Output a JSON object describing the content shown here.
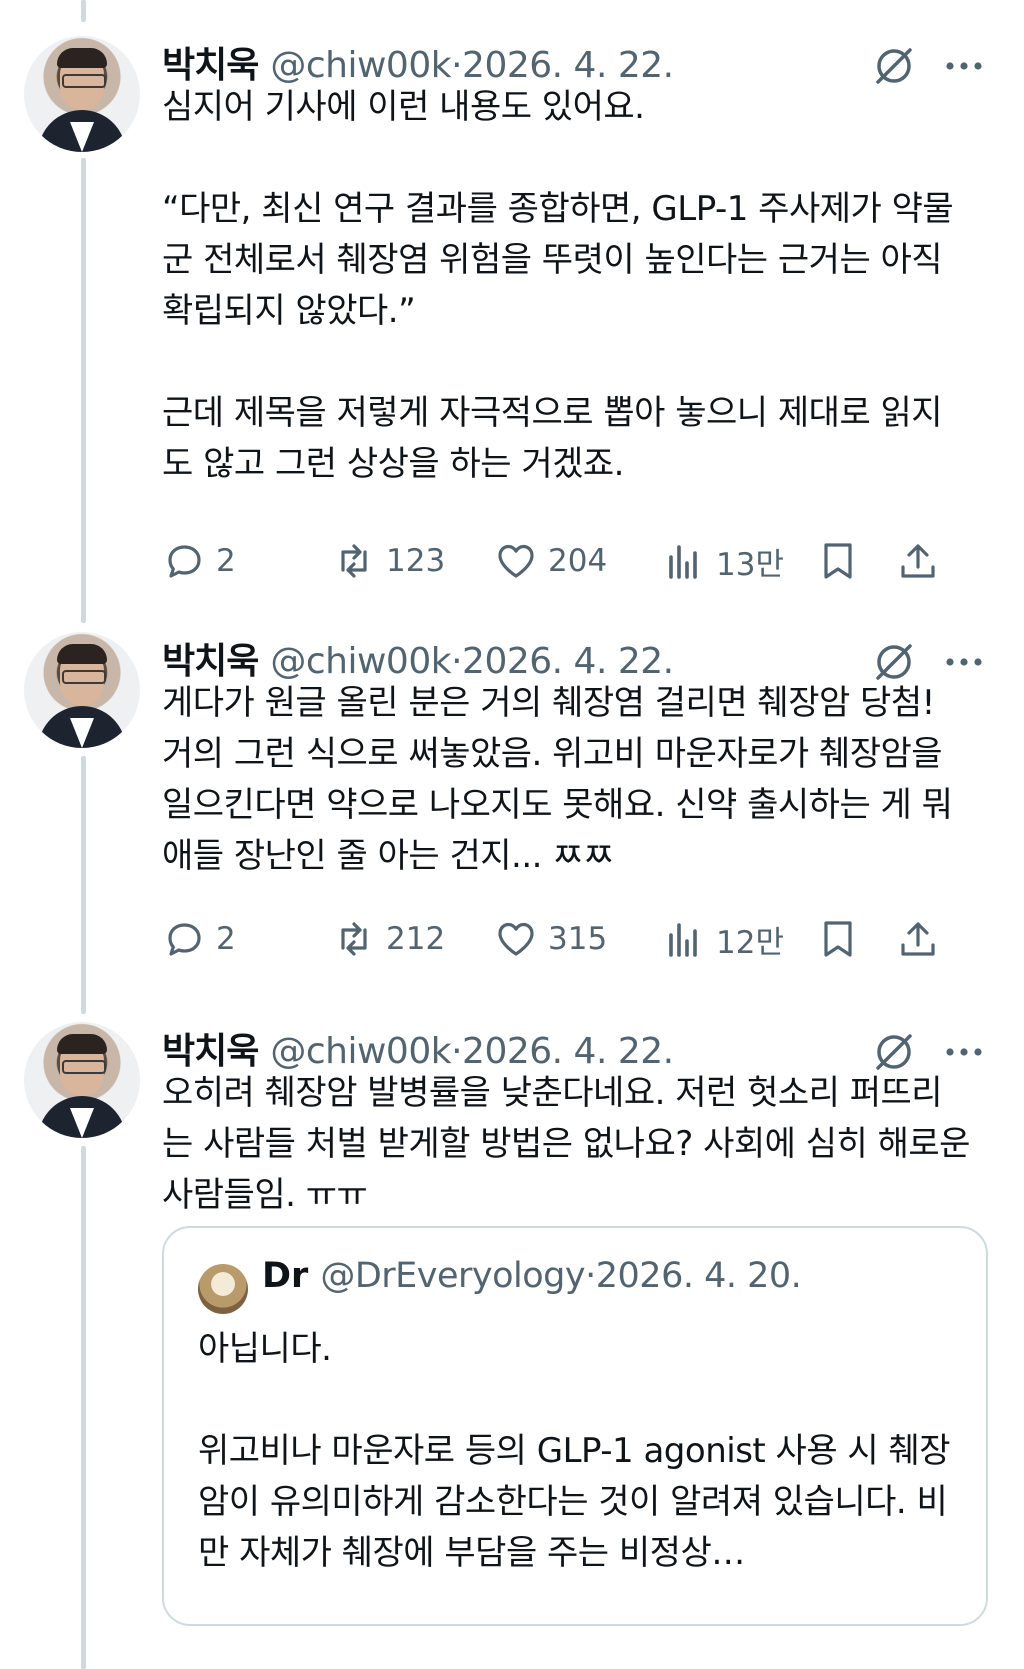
{
  "tweets": [
    {
      "name": "박치욱",
      "handle": "@chiw00k",
      "separator": "·",
      "date": "2026. 4. 22.",
      "text": "심지어 기사에 이런 내용도 있어요.\n\n“다만, 최신 연구 결과를 종합하면, GLP-1 주사제가 약물군 전체로서 췌장염 위험을 뚜렷이 높인다는 근거는 아직 확립되지 않았다.”\n\n근데 제목을 저렇게 자극적으로 뽑아 놓으니 제대로 읽지도 않고 그런 상상을 하는 거겠죠.",
      "replies": "2",
      "reposts": "123",
      "likes": "204",
      "views": "13만"
    },
    {
      "name": "박치욱",
      "handle": "@chiw00k",
      "separator": "·",
      "date": "2026. 4. 22.",
      "text": "게다가 원글 올린 분은 거의 췌장염 걸리면 췌장암 당첨! 거의 그런 식으로 써놓았음. 위고비 마운자로가 췌장암을 일으킨다면 약으로 나오지도 못해요. 신약 출시하는 게 뭐 애들 장난인 줄 아는 건지... ㅉㅉ",
      "replies": "2",
      "reposts": "212",
      "likes": "315",
      "views": "12만"
    },
    {
      "name": "박치욱",
      "handle": "@chiw00k",
      "separator": "·",
      "date": "2026. 4. 22.",
      "text": "오히려 췌장암 발병률을 낮춘다네요. 저런 헛소리 퍼뜨리는 사람들 처벌 받게할 방법은 없나요? 사회에 심히 해로운 사람들임. ㅠㅠ"
    }
  ],
  "quote": {
    "name": "Dr",
    "handle": "@DrEveryology",
    "separator": "·",
    "date": "2026. 4. 20.",
    "text": "아닙니다.\n\n위고비나 마운자로 등의 GLP-1 agonist 사용 시 췌장암이 유의미하게 감소한다는 것이 알려져 있습니다. 비만 자체가 췌장에 부담을 주는 비정상…"
  },
  "icons": {
    "reply": "reply-icon",
    "repost": "repost-icon",
    "like": "heart-icon",
    "views": "views-icon",
    "bookmark": "bookmark-icon",
    "share": "share-icon",
    "grok": "grok-icon",
    "more": "more-icon"
  },
  "colors": {
    "text": "#0f1419",
    "muted": "#536471",
    "line": "#cfd9de"
  }
}
